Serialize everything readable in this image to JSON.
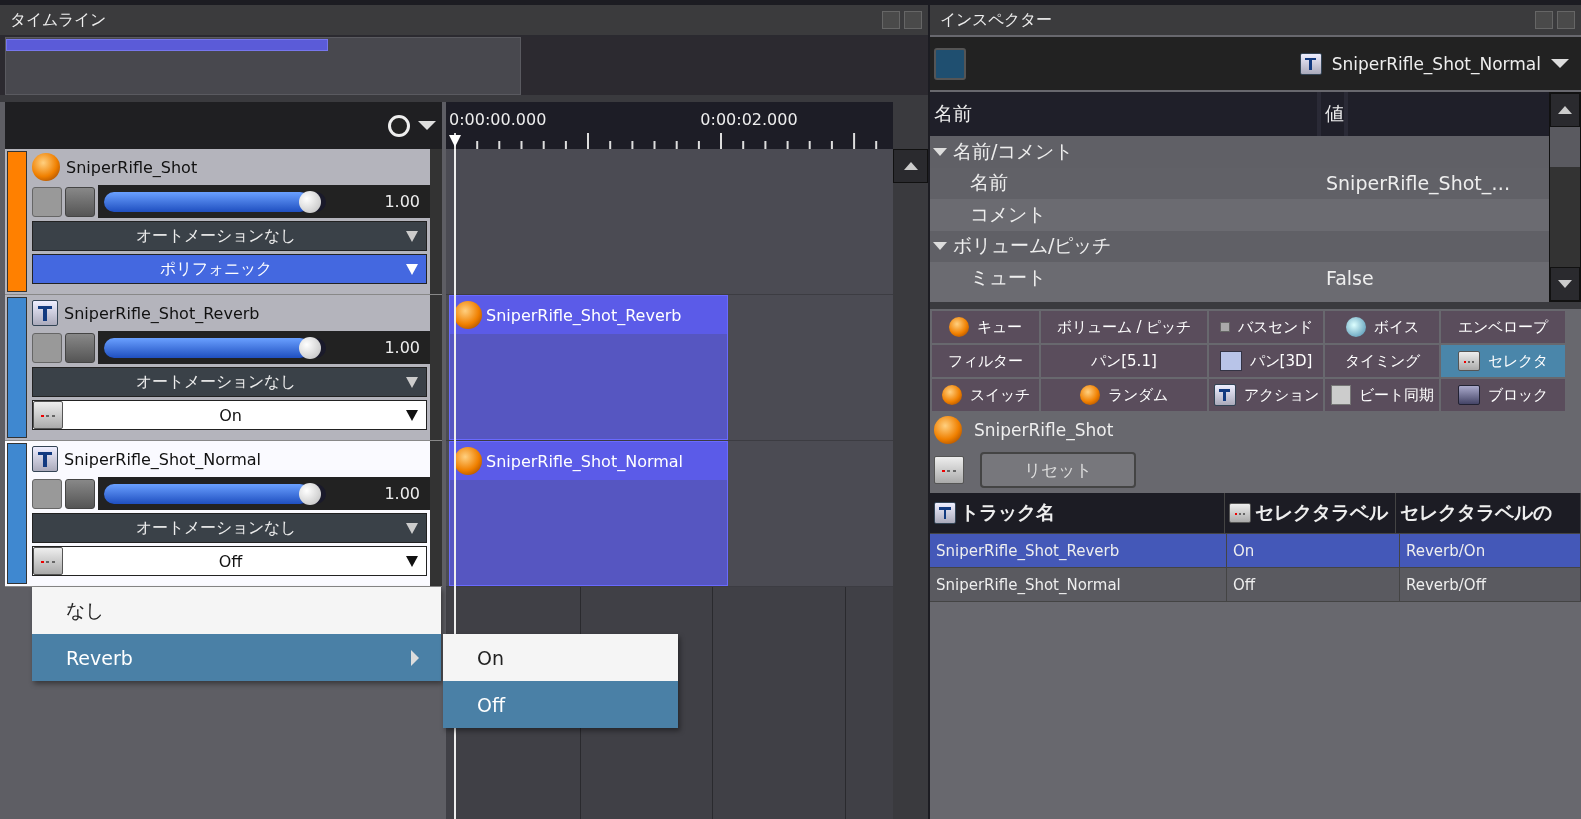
{
  "timeline": {
    "title": "タイムライン",
    "ruler": [
      "0:00:00.000",
      "0:00:02.000"
    ],
    "tracks": [
      {
        "name": "SniperRifle_Shot",
        "kind": "cue",
        "color": "#ff8000",
        "selected": false,
        "volume": {
          "level": 0.93,
          "reading": "1.00"
        },
        "automation": "オートメーションなし",
        "mode": {
          "kind": "play_mode",
          "value": "ポリフォニック"
        }
      },
      {
        "name": "SniperRifle_Shot_Reverb",
        "kind": "track",
        "color": "#3f88d0",
        "selected": false,
        "volume": {
          "level": 0.93,
          "reading": "1.00"
        },
        "automation": "オートメーションなし",
        "mode": {
          "kind": "selector",
          "value": "On"
        },
        "clip": {
          "label": "SniperRifle_Shot_Reverb"
        }
      },
      {
        "name": "SniperRifle_Shot_Normal",
        "kind": "track",
        "color": "#3f88d0",
        "selected": true,
        "volume": {
          "level": 0.93,
          "reading": "1.00"
        },
        "automation": "オートメーションなし",
        "mode": {
          "kind": "selector",
          "value": "Off"
        },
        "clip": {
          "label": "SniperRifle_Shot_Normal"
        }
      }
    ],
    "menu": {
      "items": [
        {
          "label": "なし",
          "selected": false,
          "has_submenu": false
        },
        {
          "label": "Reverb",
          "selected": true,
          "has_submenu": true
        }
      ],
      "submenu": [
        {
          "label": "On",
          "selected": false
        },
        {
          "label": "Off",
          "selected": true
        }
      ]
    }
  },
  "inspector": {
    "title": "インスペクター",
    "target": {
      "name": "SniperRifle_Shot_Normal"
    },
    "properties": {
      "columns": [
        "名前",
        "値"
      ],
      "rows": [
        {
          "kind": "group",
          "label": "名前/コメント",
          "expanded": true
        },
        {
          "kind": "item",
          "label": "名前",
          "value": "SniperRifle_Shot_…"
        },
        {
          "kind": "item",
          "label": "コメント"
        },
        {
          "kind": "group",
          "label": "ボリューム/ピッチ",
          "expanded": true
        },
        {
          "kind": "item",
          "label": "ミュート",
          "value": "False"
        }
      ]
    },
    "tabs": [
      {
        "label": "キュー",
        "selected": false
      },
      {
        "label": "ボリューム / ピッチ",
        "selected": false
      },
      {
        "label": "バスセンド",
        "selected": false
      },
      {
        "label": "ボイス",
        "selected": false
      },
      {
        "label": "エンベロープ",
        "selected": false
      },
      {
        "label": "フィルター",
        "selected": false
      },
      {
        "label": "パン[5.1]",
        "selected": false
      },
      {
        "label": "パン[3D]",
        "selected": false
      },
      {
        "label": "タイミング",
        "selected": false
      },
      {
        "label": "セレクタ",
        "selected": true
      },
      {
        "label": "スイッチ",
        "selected": false
      },
      {
        "label": "ランダム",
        "selected": false
      },
      {
        "label": "アクション",
        "selected": false
      },
      {
        "label": "ビート同期",
        "selected": false
      },
      {
        "label": "ブロック",
        "selected": false
      }
    ],
    "cue": {
      "name": "SniperRifle_Shot"
    },
    "reset_button": "リセット",
    "table": {
      "columns": [
        "トラック名",
        "セレクタラベル",
        "セレクタラベルの"
      ],
      "rows": [
        {
          "cells": [
            "SniperRifle_Shot_Reverb",
            "On",
            "Reverb/On"
          ],
          "selected": true
        },
        {
          "cells": [
            "SniperRifle_Shot_Normal",
            "Off",
            "Reverb/Off"
          ],
          "selected": false
        }
      ]
    }
  }
}
